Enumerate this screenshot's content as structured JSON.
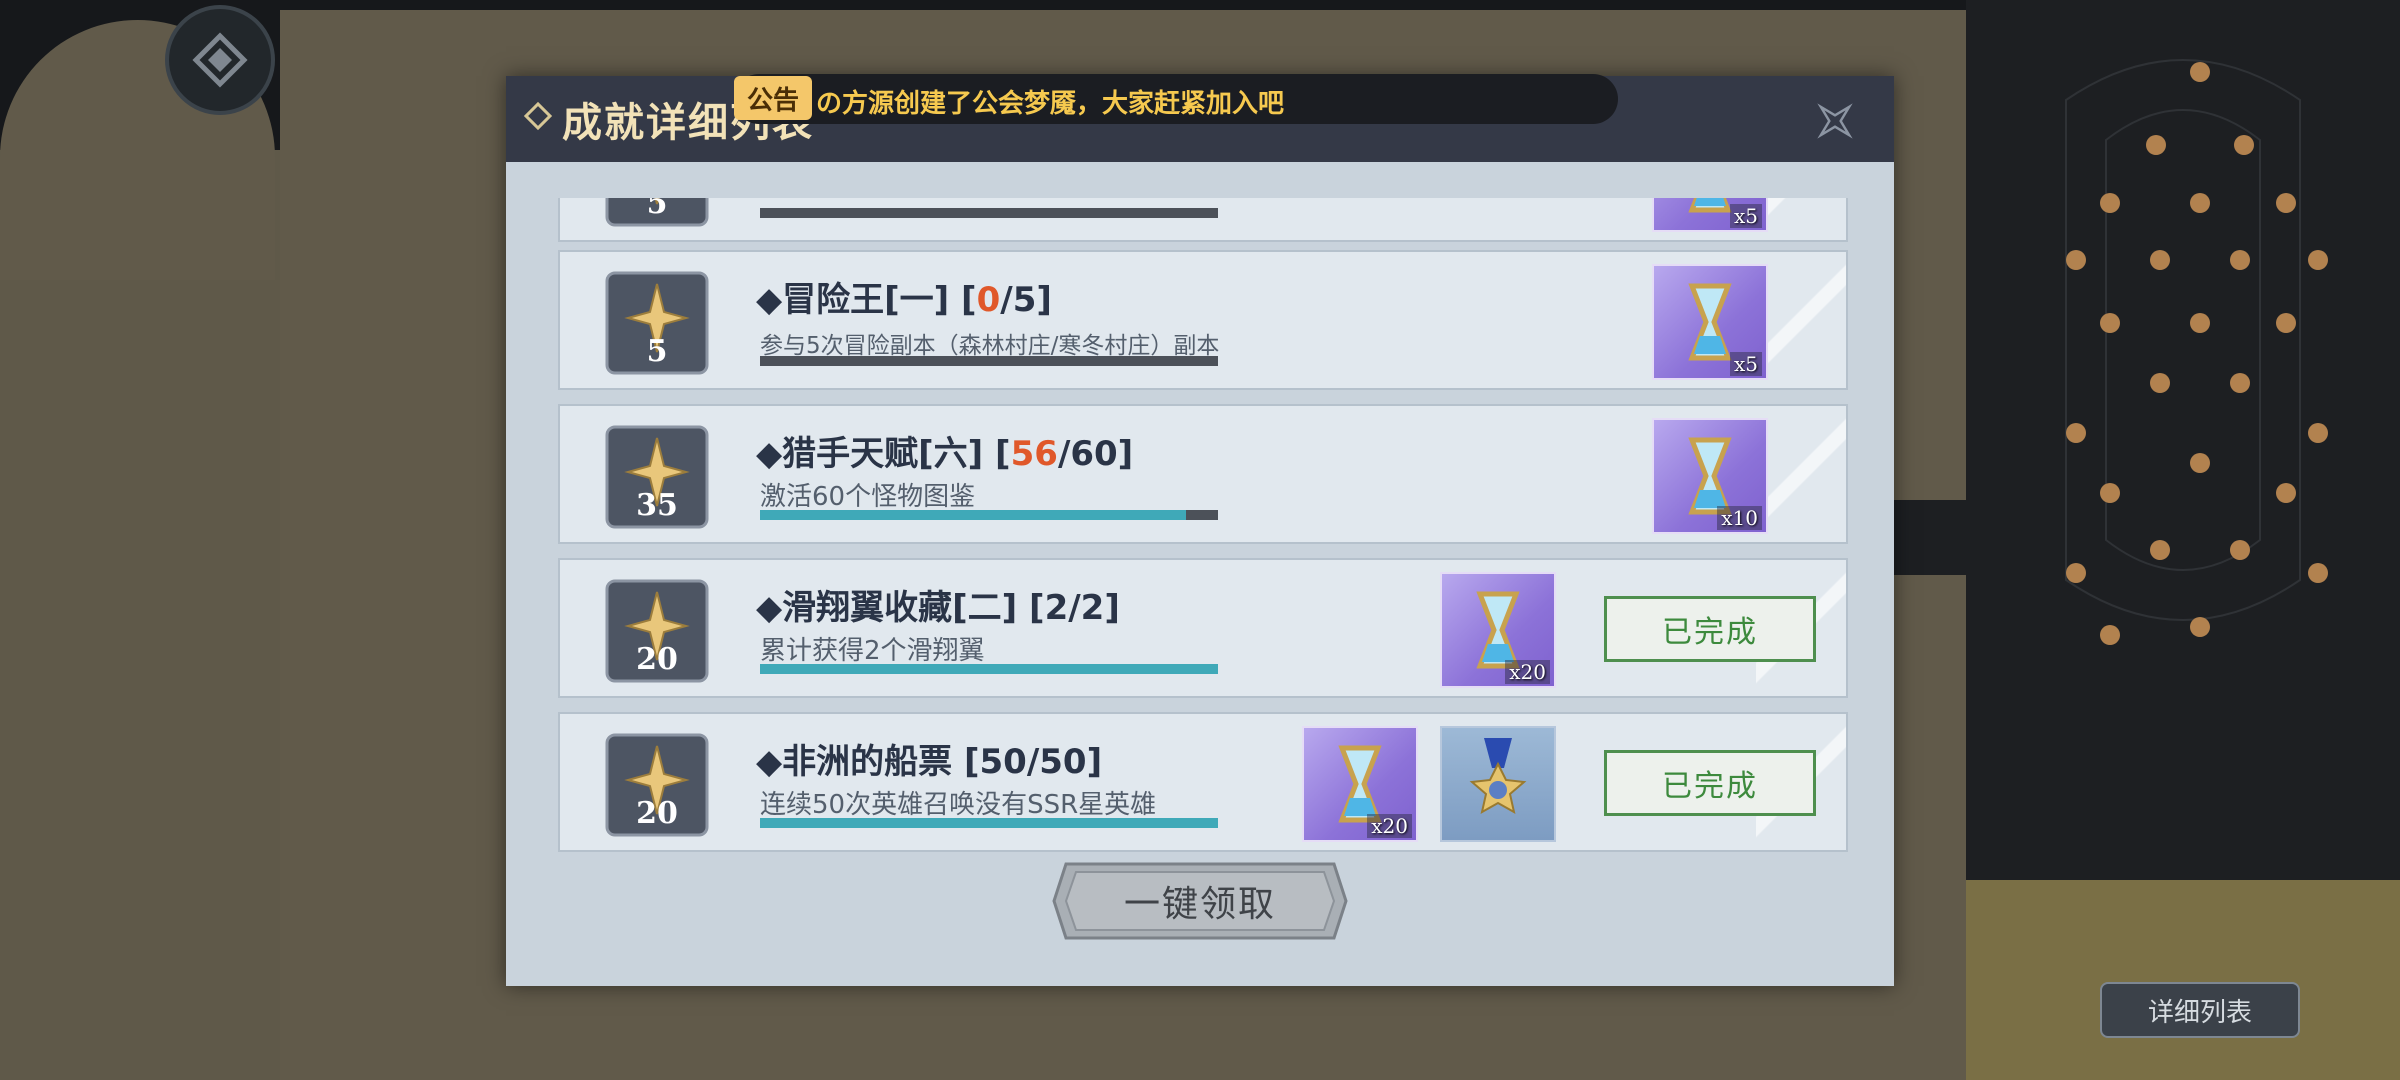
{
  "dialog": {
    "title": "成就详细列表"
  },
  "notice": {
    "badge": "公告",
    "text": "の方源创建了公会梦魇，大家赶紧加入吧"
  },
  "rows": [
    {
      "points": "5",
      "reward_count": "x5"
    },
    {
      "points": "5",
      "title_prefix": "◆冒险王[一] [",
      "current": "0",
      "title_suffix": "/5]",
      "desc": "参与5次冒险副本（森林村庄/寒冬村庄）副本",
      "progress": 0,
      "rewards": [
        "x5"
      ]
    },
    {
      "points": "35",
      "title_prefix": "◆猎手天赋[六] [",
      "current": "56",
      "title_suffix": "/60]",
      "desc": "激活60个怪物图鉴",
      "progress": 0.93,
      "rewards": [
        "x10"
      ]
    },
    {
      "points": "20",
      "title": "◆滑翔翼收藏[二] [2/2]",
      "desc": "累计获得2个滑翔翼",
      "progress": 1.0,
      "rewards": [
        "x20"
      ],
      "status": "已完成"
    },
    {
      "points": "20",
      "title": "◆非洲的船票 [50/50]",
      "desc": "连续50次英雄召唤没有SSR星英雄",
      "progress": 1.0,
      "rewards": [
        "x20",
        "medal"
      ],
      "status": "已完成"
    }
  ],
  "claim_all_label": "一键领取",
  "side": {
    "detail_list_label": "详细列表"
  },
  "icons": {
    "back": "back-diamond-icon",
    "close": "close-x-icon",
    "reward": "hourglass-icon",
    "medal": "medal-icon",
    "badge": "star-badge-icon"
  },
  "colors": {
    "progress_fill": "#3fa9b8",
    "progress_track": "#4c5159",
    "current_highlight": "#e0582a",
    "done_green": "#3d8a3d",
    "notice_text": "#f6c94f"
  }
}
